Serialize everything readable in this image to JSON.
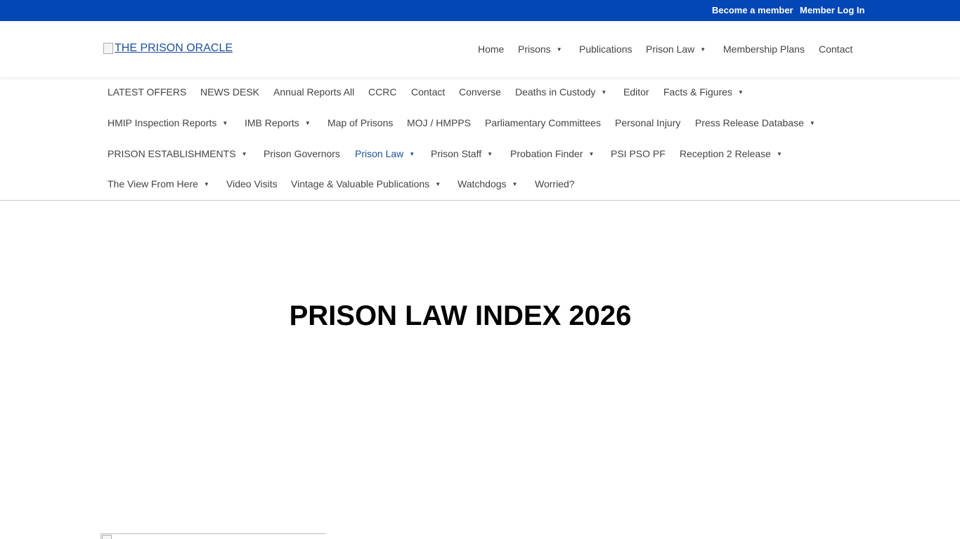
{
  "topbar": {
    "become_member": "Become a member",
    "member_login": "Member Log In"
  },
  "header": {
    "logo_alt": "THE PRISON ORACLE"
  },
  "main_nav": [
    {
      "label": "Home",
      "dropdown": false
    },
    {
      "label": "Prisons",
      "dropdown": true
    },
    {
      "label": "Publications",
      "dropdown": false
    },
    {
      "label": "Prison Law",
      "dropdown": true
    },
    {
      "label": "Membership Plans",
      "dropdown": false
    },
    {
      "label": "Contact",
      "dropdown": false
    }
  ],
  "secondary_nav": {
    "row1": [
      {
        "label": "LATEST OFFERS",
        "dropdown": false
      },
      {
        "label": "NEWS DESK",
        "dropdown": false
      },
      {
        "label": "Annual Reports All",
        "dropdown": false
      },
      {
        "label": "CCRC",
        "dropdown": false
      },
      {
        "label": "Contact",
        "dropdown": false
      },
      {
        "label": "Converse",
        "dropdown": false
      },
      {
        "label": "Deaths in Custody",
        "dropdown": true
      },
      {
        "label": "Editor",
        "dropdown": false
      },
      {
        "label": "Facts & Figures",
        "dropdown": true
      }
    ],
    "row2": [
      {
        "label": "HMIP Inspection Reports",
        "dropdown": true
      },
      {
        "label": "IMB Reports",
        "dropdown": true
      },
      {
        "label": "Map of Prisons",
        "dropdown": false
      },
      {
        "label": "MOJ / HMPPS",
        "dropdown": false
      },
      {
        "label": "Parliamentary Committees",
        "dropdown": false
      },
      {
        "label": "Personal Injury",
        "dropdown": false
      },
      {
        "label": "Press Release Database",
        "dropdown": true
      }
    ],
    "row3": [
      {
        "label": "PRISON ESTABLISHMENTS",
        "dropdown": true
      },
      {
        "label": "Prison Governors",
        "dropdown": false
      },
      {
        "label": "Prison Law",
        "dropdown": true,
        "active": true
      },
      {
        "label": "Prison Staff",
        "dropdown": true
      },
      {
        "label": "Probation Finder",
        "dropdown": true
      },
      {
        "label": "PSI PSO PF",
        "dropdown": false
      },
      {
        "label": "Reception 2 Release",
        "dropdown": true
      }
    ],
    "row4": [
      {
        "label": "The View From Here",
        "dropdown": true
      },
      {
        "label": "Video Visits",
        "dropdown": false
      },
      {
        "label": "Vintage & Valuable Publications",
        "dropdown": true
      },
      {
        "label": "Watchdogs",
        "dropdown": true
      },
      {
        "label": "Worried?",
        "dropdown": false
      }
    ]
  },
  "page": {
    "title": "PRISON LAW INDEX 2026"
  },
  "colors": {
    "topbar_bg": "#0247b5",
    "accent": "#1d4fa0",
    "nav_text": "#444444",
    "title_text": "#000000"
  },
  "icons": {
    "dropdown": "caret-down-icon"
  }
}
